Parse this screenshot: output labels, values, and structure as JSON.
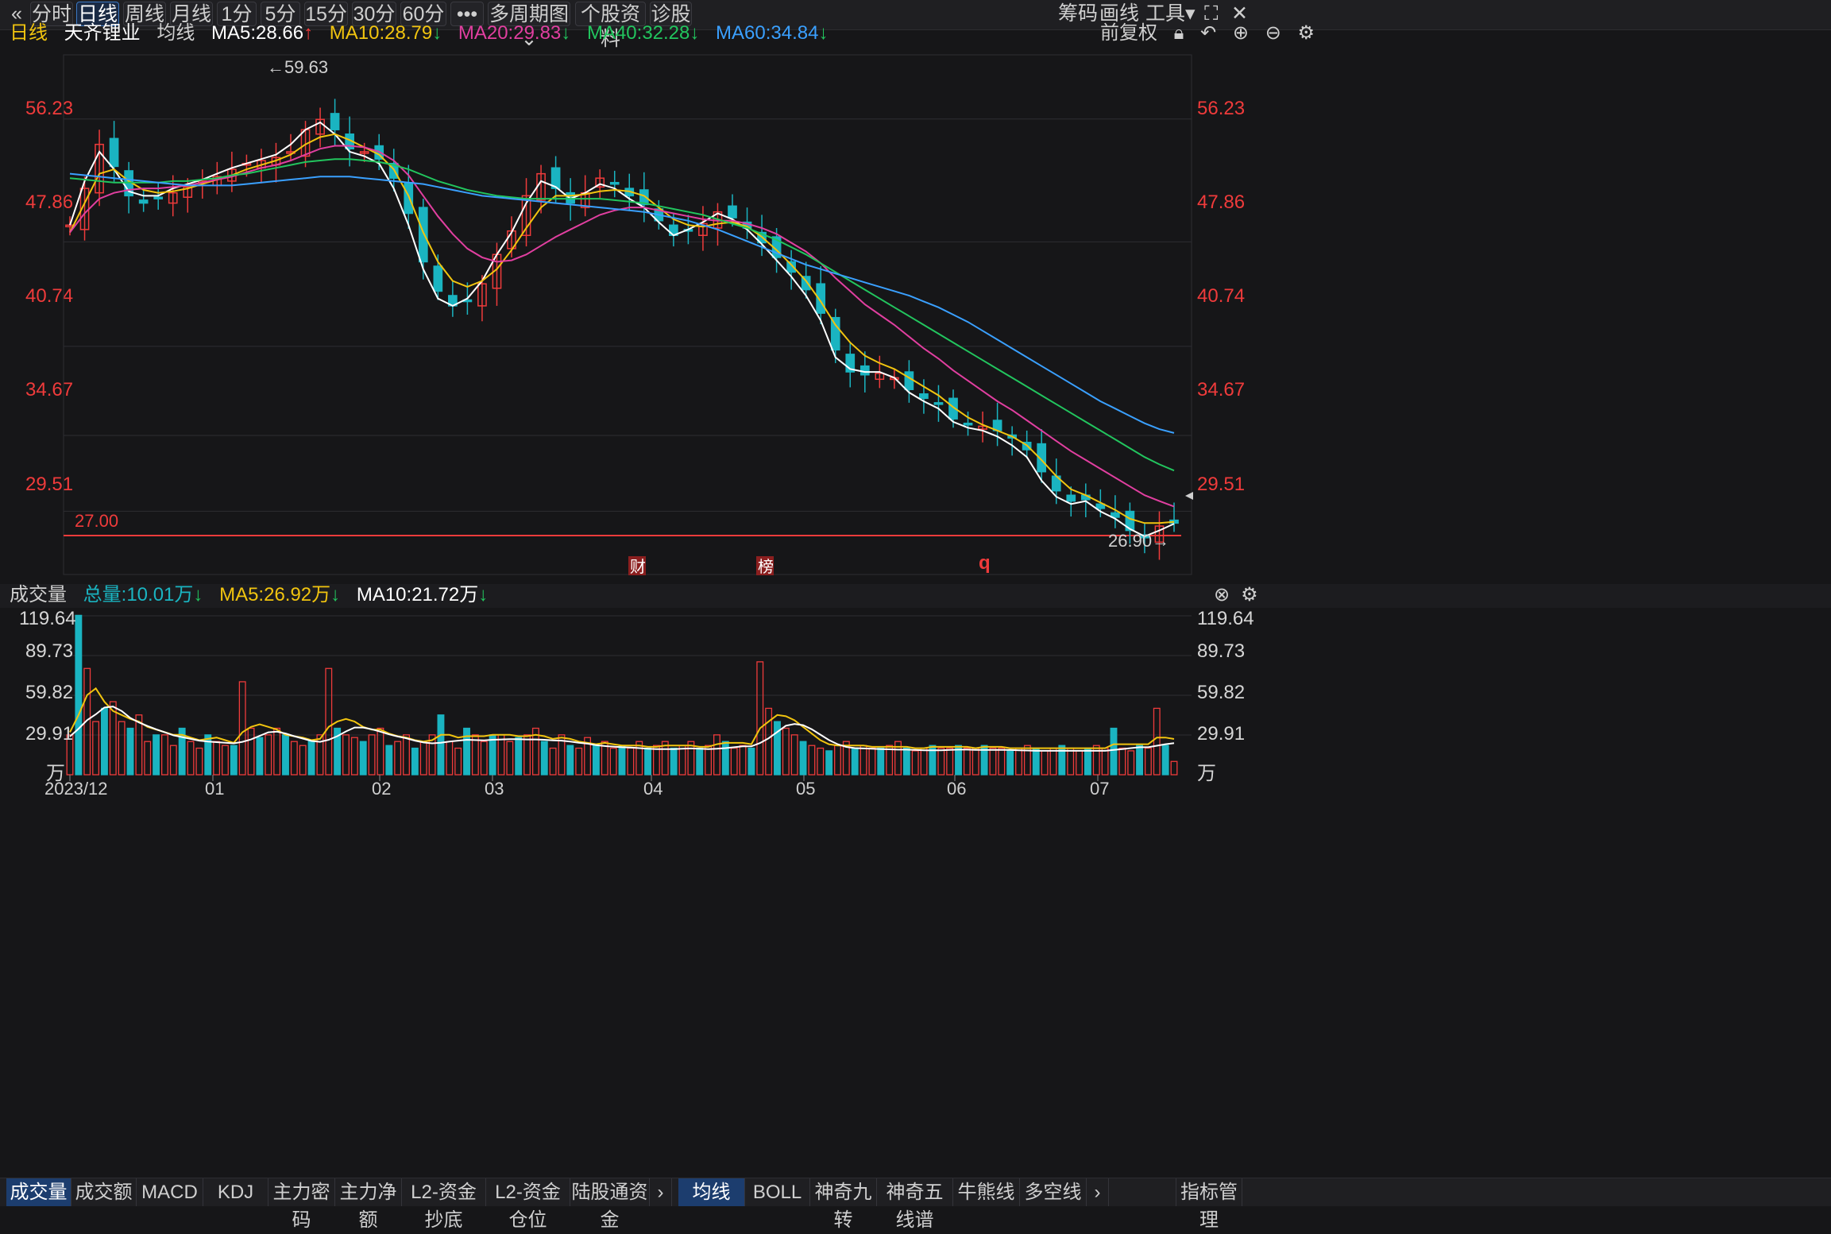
{
  "toolbar": {
    "collapse_icon": "«",
    "periods": [
      "分时",
      "日线",
      "周线",
      "月线",
      "1分",
      "5分",
      "15分",
      "30分",
      "60分"
    ],
    "active_period": "日线",
    "more_icon": "•••",
    "multi_period": "多周期图",
    "stock_info": "个股资料",
    "diagnose": "诊股",
    "right": {
      "chip": "筹码",
      "draw": "画线",
      "tools": "工具"
    }
  },
  "price_legend": {
    "period": "日线",
    "stock": "天齐锂业",
    "ma_label": "均线",
    "ma5": "MA5:28.66",
    "ma10": "MA10:28.79",
    "ma20": "MA20:29.83",
    "ma40": "MA40:32.28",
    "ma60": "MA60:34.84",
    "adjust": "前复权"
  },
  "volume_legend": {
    "name": "成交量",
    "total": "总量:10.01万",
    "ma5": "MA5:26.92万",
    "ma10": "MA10:21.72万"
  },
  "colors": {
    "up": "#ef3b3b",
    "down": "#1ab4c1",
    "ma5": "#ffffff",
    "ma10": "#f1c40f",
    "ma20": "#e13fa0",
    "ma40": "#22c55e",
    "ma60": "#3aa0ff",
    "bg": "#161618",
    "grid": "#2d2d32"
  },
  "chart_data": [
    {
      "type": "candlestick",
      "title": "天齐锂业 日线",
      "yticks": [
        "56.23",
        "47.86",
        "40.74",
        "34.67",
        "29.51"
      ],
      "ylim": [
        25.2,
        60.6
      ],
      "support_line": {
        "label": "27.00",
        "value": 27.0
      },
      "annotations": {
        "high": "←59.63",
        "low": "26.90→",
        "markers": [
          "财",
          "榜",
          "q"
        ]
      },
      "xticks": [
        "2023/12",
        "01",
        "02",
        "03",
        "04",
        "05",
        "06",
        "07"
      ],
      "close_trend": [
        49,
        51.5,
        54.5,
        53,
        51,
        50.5,
        50.8,
        51.2,
        51.6,
        52,
        52.3,
        52.8,
        53.2,
        53.4,
        53.6,
        54,
        55.5,
        56.2,
        55.5,
        54.2,
        54,
        53.5,
        52.2,
        49.8,
        46.5,
        44.5,
        43.5,
        43.8,
        45,
        47,
        48.6,
        51,
        52.5,
        51.5,
        50.5,
        51.2,
        52.2,
        51.8,
        51,
        50.4,
        49.3,
        48.3,
        48.6,
        49.1,
        49.9,
        49.5,
        48.8,
        47.8,
        46.8,
        45.8,
        44.6,
        43,
        40.5,
        39,
        38.8,
        38.9,
        38.6,
        37.8,
        37.2,
        36.8,
        35.8,
        35.4,
        35.3,
        35,
        34.5,
        33.7,
        32.2,
        30.9,
        30.2,
        30.3,
        29.7,
        29.1,
        28.2,
        27.7,
        28.5,
        28.7
      ],
      "series": [
        {
          "name": "MA5",
          "values": [
            49,
            52,
            54,
            52.8,
            51.3,
            51,
            51,
            51.5,
            51.8,
            52.1,
            52.5,
            52.9,
            53.2,
            53.5,
            53.8,
            54.5,
            55.5,
            56,
            55.2,
            54,
            53.7,
            53.2,
            51.5,
            49,
            46,
            44,
            43.5,
            44,
            45.2,
            47,
            48.5,
            50.5,
            52,
            51.6,
            50.8,
            51.2,
            51.8,
            51.5,
            50.8,
            50.2,
            49.2,
            48.3,
            48.7,
            49.2,
            49.8,
            49.4,
            48.7,
            47.7,
            46.6,
            45.5,
            44.2,
            42.5,
            40,
            39.2,
            39,
            39,
            38.6,
            37.6,
            37,
            36.5,
            35.6,
            35.2,
            35,
            34.6,
            34,
            33.2,
            31.6,
            30.5,
            30,
            30.2,
            29.5,
            29,
            28.3,
            27.8,
            28.2,
            28.66
          ]
        },
        {
          "name": "MA10",
          "values": [
            48.5,
            50.5,
            52.5,
            52.8,
            52,
            51.4,
            51.2,
            51.3,
            51.5,
            51.8,
            52.1,
            52.4,
            52.8,
            53.1,
            53.4,
            53.8,
            54.5,
            55,
            55.2,
            54.8,
            54.3,
            53.8,
            52.8,
            51,
            48.5,
            46.5,
            45.2,
            44.8,
            45.2,
            46,
            47.3,
            48.8,
            50.2,
            51,
            51,
            51.1,
            51.3,
            51.4,
            51.3,
            51,
            50.2,
            49.4,
            49,
            48.9,
            49.1,
            49.2,
            48.9,
            48.2,
            47.3,
            46.3,
            45.2,
            43.8,
            42.2,
            41,
            40.1,
            39.6,
            39.2,
            38.6,
            38,
            37.4,
            36.6,
            35.9,
            35.4,
            35,
            34.6,
            34,
            33,
            31.9,
            31,
            30.6,
            30.1,
            29.6,
            29,
            28.7,
            28.7,
            28.79
          ]
        },
        {
          "name": "MA20",
          "values": [
            48.5,
            49.8,
            50.8,
            51.2,
            51.4,
            51.5,
            51.5,
            51.6,
            51.7,
            51.9,
            52.1,
            52.3,
            52.6,
            52.9,
            53.1,
            53.4,
            53.8,
            54.2,
            54.4,
            54.4,
            54.3,
            54,
            53.4,
            52.4,
            51,
            49.6,
            48.4,
            47.4,
            46.8,
            46.5,
            46.6,
            47,
            47.6,
            48.2,
            48.7,
            49.2,
            49.7,
            50,
            50.2,
            50.2,
            50,
            49.8,
            49.6,
            49.4,
            49.3,
            49.3,
            49.1,
            48.8,
            48.4,
            47.8,
            47.2,
            46.4,
            45.4,
            44.5,
            43.6,
            42.9,
            42.2,
            41.4,
            40.6,
            39.9,
            39.1,
            38.4,
            37.7,
            37,
            36.4,
            35.7,
            35,
            34.3,
            33.6,
            33,
            32.4,
            31.8,
            31.2,
            30.6,
            30.2,
            29.83
          ]
        },
        {
          "name": "MA40",
          "values": [
            52.2,
            52.1,
            52,
            51.9,
            51.9,
            51.9,
            51.9,
            52,
            52,
            52.1,
            52.2,
            52.4,
            52.5,
            52.7,
            52.9,
            53.1,
            53.3,
            53.4,
            53.5,
            53.5,
            53.4,
            53.3,
            53.1,
            52.8,
            52.4,
            52,
            51.7,
            51.4,
            51.2,
            51,
            50.9,
            50.8,
            50.8,
            50.8,
            50.8,
            50.8,
            50.8,
            50.7,
            50.6,
            50.5,
            50.3,
            50.1,
            49.9,
            49.7,
            49.4,
            49.1,
            48.8,
            48.4,
            48,
            47.5,
            47,
            46.4,
            45.8,
            45.2,
            44.6,
            44,
            43.4,
            42.8,
            42.2,
            41.6,
            41,
            40.4,
            39.8,
            39.2,
            38.6,
            38,
            37.4,
            36.8,
            36.2,
            35.6,
            35,
            34.4,
            33.8,
            33.2,
            32.7,
            32.28
          ]
        },
        {
          "name": "MA60",
          "values": [
            52.5,
            52.4,
            52.3,
            52.2,
            52.1,
            52,
            51.9,
            51.8,
            51.7,
            51.7,
            51.7,
            51.7,
            51.8,
            51.9,
            52,
            52.1,
            52.2,
            52.3,
            52.3,
            52.3,
            52.2,
            52.1,
            52,
            51.9,
            51.8,
            51.6,
            51.4,
            51.2,
            51,
            50.9,
            50.8,
            50.7,
            50.6,
            50.5,
            50.4,
            50.3,
            50.2,
            50.1,
            50,
            49.9,
            49.7,
            49.5,
            49.3,
            49,
            48.7,
            48.3,
            47.9,
            47.5,
            47.1,
            46.7,
            46.3,
            46,
            45.7,
            45.4,
            45.1,
            44.8,
            44.5,
            44.2,
            43.8,
            43.4,
            42.9,
            42.4,
            41.8,
            41.2,
            40.6,
            40,
            39.4,
            38.8,
            38.2,
            37.6,
            37,
            36.5,
            36,
            35.5,
            35.1,
            34.84
          ]
        }
      ]
    },
    {
      "type": "bar",
      "title": "成交量",
      "yticks": [
        "119.64",
        "89.73",
        "59.82",
        "29.91"
      ],
      "unit": "万",
      "ylim": [
        0,
        119.64
      ],
      "values": [
        30,
        120,
        80,
        40,
        50,
        55,
        40,
        35,
        45,
        25,
        30,
        30,
        22,
        35,
        25,
        20,
        30,
        25,
        22,
        22,
        70,
        35,
        28,
        30,
        35,
        30,
        25,
        22,
        25,
        30,
        80,
        35,
        30,
        28,
        25,
        30,
        35,
        22,
        25,
        30,
        20,
        25,
        30,
        45,
        25,
        20,
        35,
        30,
        25,
        30,
        30,
        25,
        28,
        30,
        35,
        25,
        20,
        30,
        22,
        20,
        28,
        22,
        25,
        20,
        22,
        20,
        25,
        20,
        22,
        25,
        20,
        22,
        25,
        20,
        22,
        30,
        25,
        20,
        22,
        20,
        85,
        50,
        40,
        35,
        30,
        25,
        22,
        20,
        18,
        22,
        25,
        20,
        22,
        20,
        20,
        22,
        25,
        20,
        18,
        20,
        22,
        20,
        20,
        22,
        20,
        20,
        22,
        20,
        20,
        18,
        20,
        22,
        20,
        18,
        20,
        22,
        20,
        18,
        20,
        22,
        20,
        35,
        20,
        18,
        22,
        20,
        50,
        22,
        10
      ],
      "ma5": [
        32,
        45,
        60,
        65,
        55,
        48,
        45,
        42,
        40,
        36,
        34,
        32,
        30,
        30,
        28,
        26,
        27,
        28,
        26,
        24,
        32,
        36,
        38,
        36,
        34,
        30,
        29,
        28,
        26,
        27,
        36,
        40,
        42,
        40,
        36,
        34,
        34,
        31,
        29,
        28,
        26,
        25,
        26,
        30,
        30,
        28,
        29,
        29,
        29,
        30,
        30,
        30,
        29,
        29,
        30,
        29,
        27,
        28,
        27,
        25,
        24,
        23,
        24,
        23,
        22,
        22,
        22,
        21,
        21,
        22,
        22,
        22,
        22,
        21,
        21,
        23,
        24,
        24,
        24,
        23,
        35,
        40,
        45,
        44,
        41,
        36,
        31,
        26,
        23,
        22,
        22,
        22,
        22,
        21,
        21,
        21,
        21,
        21,
        20,
        20,
        21,
        21,
        21,
        21,
        21,
        20,
        21,
        21,
        21,
        20,
        20,
        20,
        20,
        20,
        20,
        20,
        20,
        20,
        20,
        20,
        20,
        23,
        23,
        23,
        23,
        23,
        28,
        28,
        26.92
      ]
    }
  ],
  "bottom_tabs": {
    "left": [
      "成交量",
      "成交额",
      "MACD",
      "KDJ",
      "主力密码",
      "主力净额",
      "L2-资金抄底",
      "L2-资金仓位",
      "陆股通资金"
    ],
    "middle": [
      "均线",
      "BOLL",
      "神奇九转",
      "神奇五线谱",
      "牛熊线",
      "多空线"
    ],
    "right": "指标管理"
  }
}
